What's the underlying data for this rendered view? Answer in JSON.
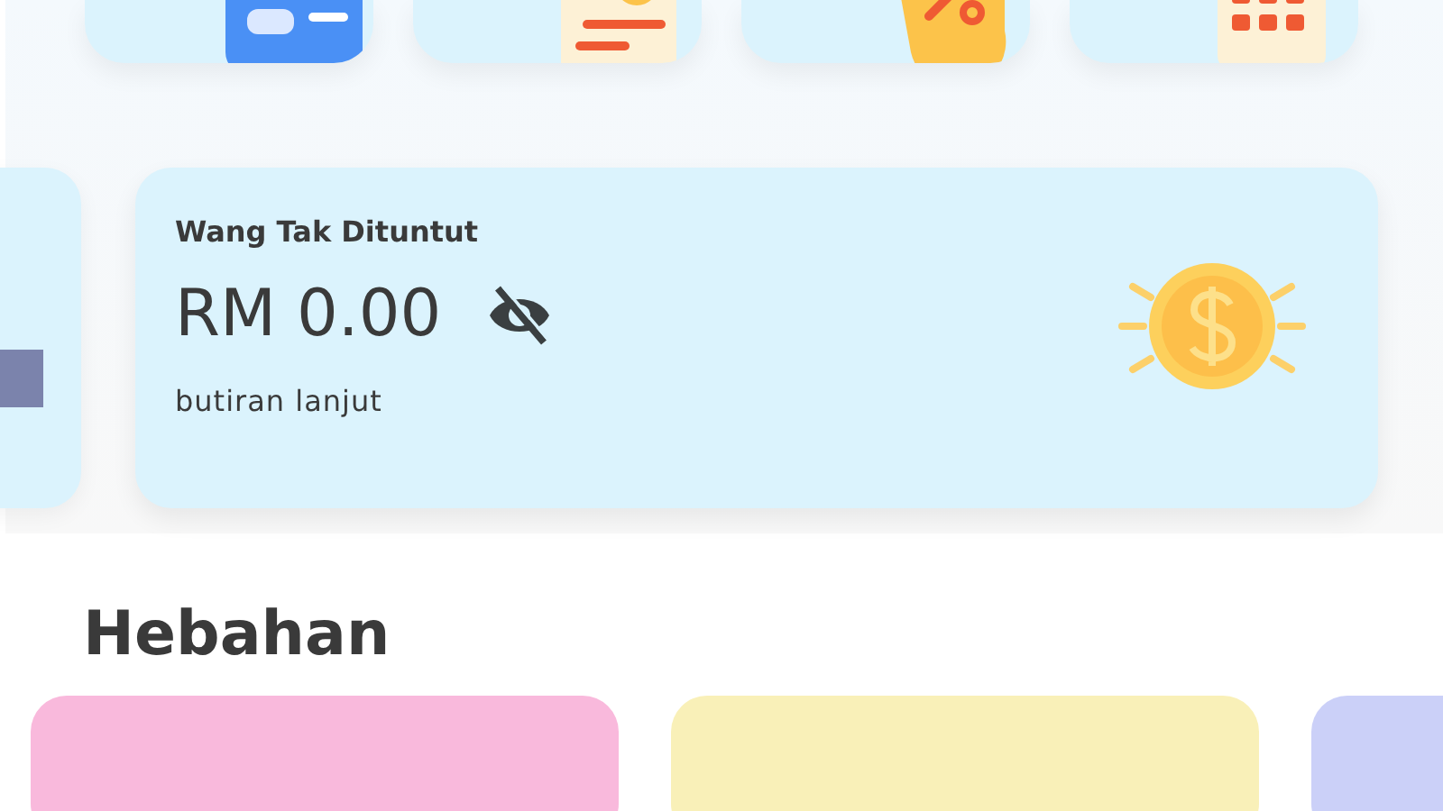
{
  "shortcuts": [
    {
      "kind": "card"
    },
    {
      "kind": "receipt"
    },
    {
      "kind": "discount"
    },
    {
      "kind": "calendar"
    }
  ],
  "balance_card": {
    "title": "Wang Tak Dituntut",
    "amount": "RM 0.00",
    "hidden": true,
    "link": "butiran lanjut"
  },
  "section_title": "Hebahan",
  "banners": [
    {
      "color": "#f9b9dc"
    },
    {
      "color": "#f9f0b8"
    },
    {
      "color": "#cbd0f8"
    }
  ]
}
